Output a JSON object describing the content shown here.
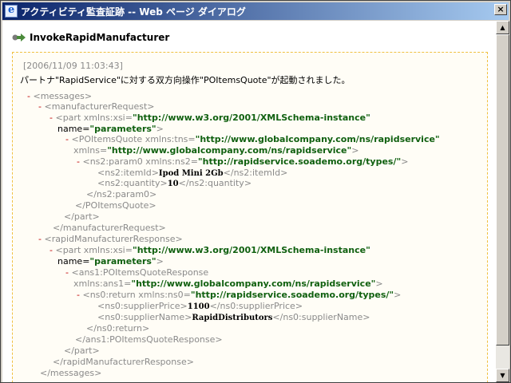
{
  "window": {
    "title": "アクティビティ監査証跡 -- Web ページ ダイアログ",
    "close_label": "×"
  },
  "header": {
    "heading": "InvokeRapidManufacturer"
  },
  "panel": {
    "timestamp": "[2006/11/09 11:03:43]",
    "message": "パートナ\"RapidService\"に対する双方向操作\"POItemsQuote\"が起動されました。"
  },
  "xml": {
    "l01": "<messages>",
    "l02": "<manufacturerRequest>",
    "l03_tag": "<part xmlns:xsi=",
    "l03_val": "\"http://www.w3.org/2001/XMLSchema-instance\"",
    "l04_name": "name=",
    "l04_val": "\"parameters\"",
    "l04_end": ">",
    "l05_tag": "<POItemsQuote xmlns:tns=",
    "l05_val": "\"http://www.globalcompany.com/ns/rapidservice\"",
    "l06_name": "xmlns=",
    "l06_val": "\"http://www.globalcompany.com/ns/rapidservice\"",
    "l06_end": ">",
    "l07_tag": "<ns2:param0 xmlns:ns2=",
    "l07_val": "\"http://rapidservice.soademo.org/types/\"",
    "l07_end": ">",
    "l08_open": "<ns2:itemId>",
    "l08_text": "Ipod Mini 2Gb",
    "l08_close": "</ns2:itemId>",
    "l09_open": "<ns2:quantity>",
    "l09_text": "10",
    "l09_close": "</ns2:quantity>",
    "l10": "</ns2:param0>",
    "l11": "</POItemsQuote>",
    "l12": "</part>",
    "l13": "</manufacturerRequest>",
    "l14": "<rapidManufacturerResponse>",
    "l15_tag": "<part xmlns:xsi=",
    "l15_val": "\"http://www.w3.org/2001/XMLSchema-instance\"",
    "l16_name": "name=",
    "l16_val": "\"parameters\"",
    "l16_end": ">",
    "l17": "<ans1:POItemsQuoteResponse",
    "l18_name": "xmlns:ans1=",
    "l18_val": "\"http://www.globalcompany.com/ns/rapidservice\"",
    "l18_end": ">",
    "l19_tag": "<ns0:return xmlns:ns0=",
    "l19_val": "\"http://rapidservice.soademo.org/types/\"",
    "l19_end": ">",
    "l20_open": "<ns0:supplierPrice>",
    "l20_text": "1100",
    "l20_close": "</ns0:supplierPrice>",
    "l21_open": "<ns0:supplierName>",
    "l21_text": "RapidDistributors",
    "l21_close": "</ns0:supplierName>",
    "l22": "</ns0:return>",
    "l23": "</ans1:POItemsQuoteResponse>",
    "l24": "</part>",
    "l25": "</rapidManufacturerResponse>",
    "l26": "</messages>",
    "minus": "-"
  },
  "icons": {
    "app": "ie-icon",
    "header": "arrow-icon",
    "close": "close-icon"
  },
  "colors": {
    "titlebar_start": "#0a246a",
    "titlebar_end": "#a6caf0",
    "attr_value": "#106010",
    "minus": "#c00000",
    "panel_border": "#f0c040"
  }
}
